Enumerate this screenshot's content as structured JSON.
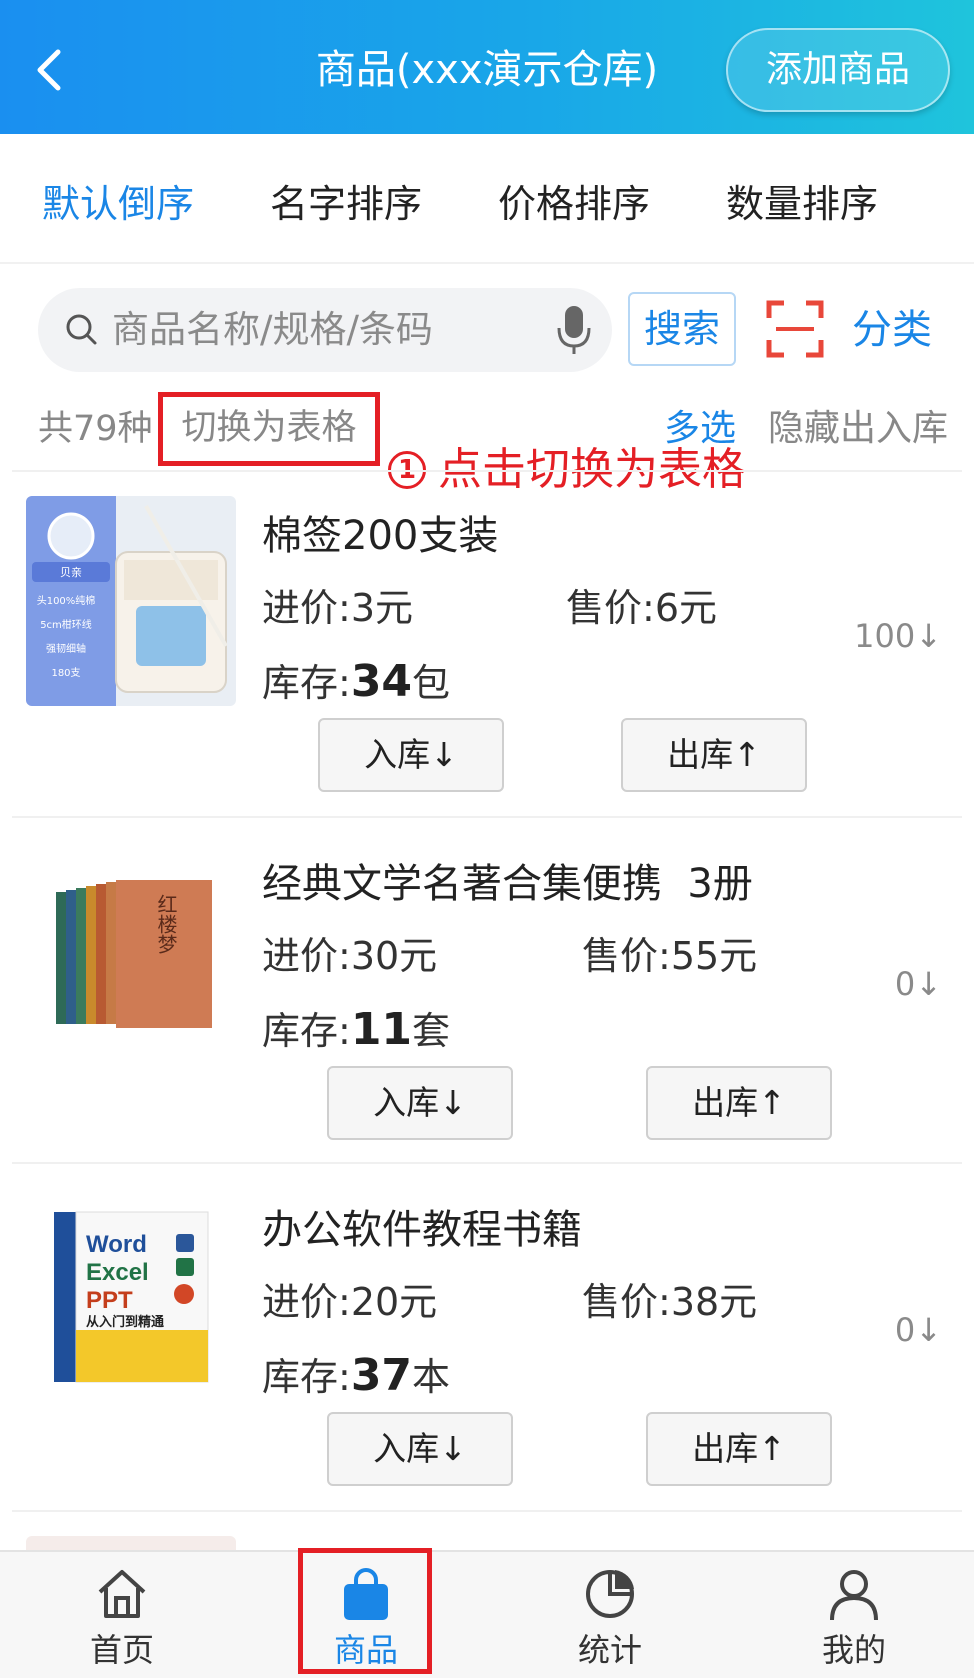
{
  "header": {
    "title": "商品(xxx演示仓库)",
    "add_button": "添加商品",
    "back_icon": "chevron-left-icon"
  },
  "sort_tabs": [
    {
      "label": "默认倒序",
      "active": true
    },
    {
      "label": "名字排序",
      "active": false
    },
    {
      "label": "价格排序",
      "active": false
    },
    {
      "label": "数量排序",
      "active": false
    }
  ],
  "search": {
    "placeholder": "商品名称/规格/条码",
    "button": "搜索",
    "category": "分类"
  },
  "toolbar": {
    "count": "共79种",
    "switch_table": "切换为表格",
    "multi_select": "多选",
    "hide_io": "隐藏出入库",
    "annotation_num": "1",
    "annotation_text": "点击切换为表格"
  },
  "products": [
    {
      "name": "棉签200支装",
      "buy_price_label": "进价:",
      "buy_price": "3元",
      "sell_price_label": "售价:",
      "sell_price": "6元",
      "stock_label": "库存:",
      "stock_qty": "34",
      "stock_unit": "包",
      "count": "100↓",
      "in_button": "入库↓",
      "out_button": "出库↑"
    },
    {
      "name": "经典文学名著合集便携  3册",
      "buy_price_label": "进价:",
      "buy_price": "30元",
      "sell_price_label": "售价:",
      "sell_price": "55元",
      "stock_label": "库存:",
      "stock_qty": "11",
      "stock_unit": "套",
      "count": "0↓",
      "in_button": "入库↓",
      "out_button": "出库↑"
    },
    {
      "name": "办公软件教程书籍",
      "buy_price_label": "进价:",
      "buy_price": "20元",
      "sell_price_label": "售价:",
      "sell_price": "38元",
      "stock_label": "库存:",
      "stock_qty": "37",
      "stock_unit": "本",
      "count": "0↓",
      "in_button": "入库↓",
      "out_button": "出库↑"
    }
  ],
  "thumb_text": {
    "cotton": [
      "贝亲",
      "头100%纯棉",
      "5cm柑环线",
      "强韧细轴",
      "180支"
    ],
    "novel": "红楼梦",
    "office": [
      "Word",
      "Excel",
      "PPT",
      "从入门到精通"
    ]
  },
  "bottom_nav": [
    {
      "label": "首页",
      "icon": "home-icon",
      "active": false
    },
    {
      "label": "商品",
      "icon": "shopping-bag-icon",
      "active": true
    },
    {
      "label": "统计",
      "icon": "pie-chart-icon",
      "active": false
    },
    {
      "label": "我的",
      "icon": "user-icon",
      "active": false
    }
  ],
  "colors": {
    "accent": "#1a86e6",
    "annotation": "#e41f25",
    "header_start": "#1a8ff0",
    "header_end": "#1fc4dc"
  }
}
